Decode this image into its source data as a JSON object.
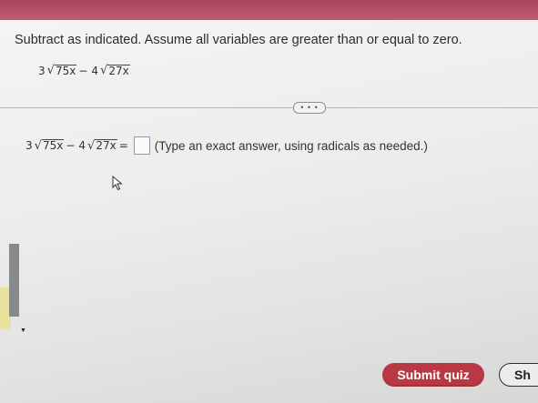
{
  "question": {
    "instruction": "Subtract as indicated. Assume all variables are greater than or equal to zero.",
    "expression": {
      "coef1": "3",
      "radicand1": "75x",
      "operator": "−",
      "coef2": "4",
      "radicand2": "27x"
    }
  },
  "more_button": {
    "label": "• • •"
  },
  "answer": {
    "equals": "=",
    "value": "",
    "hint": "(Type an exact answer, using radicals as needed.)"
  },
  "footer": {
    "submit_label": "Submit quiz",
    "show_label": "Sh"
  },
  "colors": {
    "submit_bg": "#b83844",
    "top_strip": "#b34e67"
  }
}
